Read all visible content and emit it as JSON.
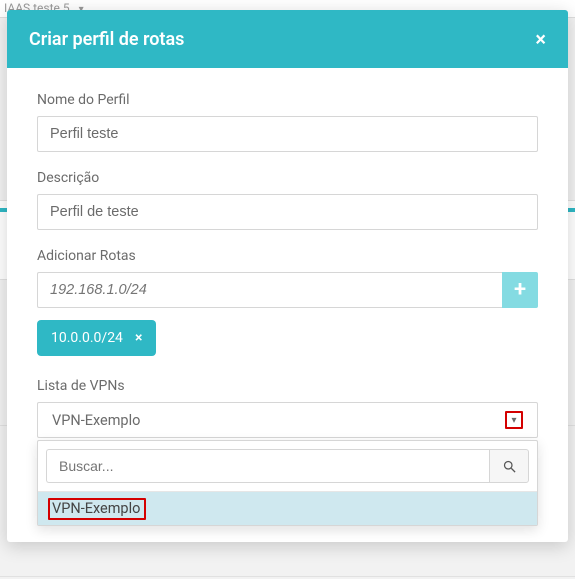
{
  "background": {
    "breadcrumb_text": "IAAS teste 5"
  },
  "modal": {
    "title": "Criar perfil de rotas",
    "close_glyph": "×",
    "fields": {
      "name_label": "Nome do Perfil",
      "name_value": "Perfil teste",
      "desc_label": "Descrição",
      "desc_value": "Perfil de teste",
      "routes_label": "Adicionar Rotas",
      "routes_placeholder": "192.168.1.0/24",
      "routes_add_glyph": "+",
      "route_chips": [
        "10.0.0.0/24"
      ],
      "chip_remove_glyph": "×",
      "vpn_label": "Lista de VPNs",
      "vpn_selected": "VPN-Exemplo",
      "vpn_caret_glyph": "▾"
    },
    "dropdown": {
      "search_placeholder": "Buscar...",
      "options": [
        "VPN-Exemplo"
      ]
    }
  }
}
